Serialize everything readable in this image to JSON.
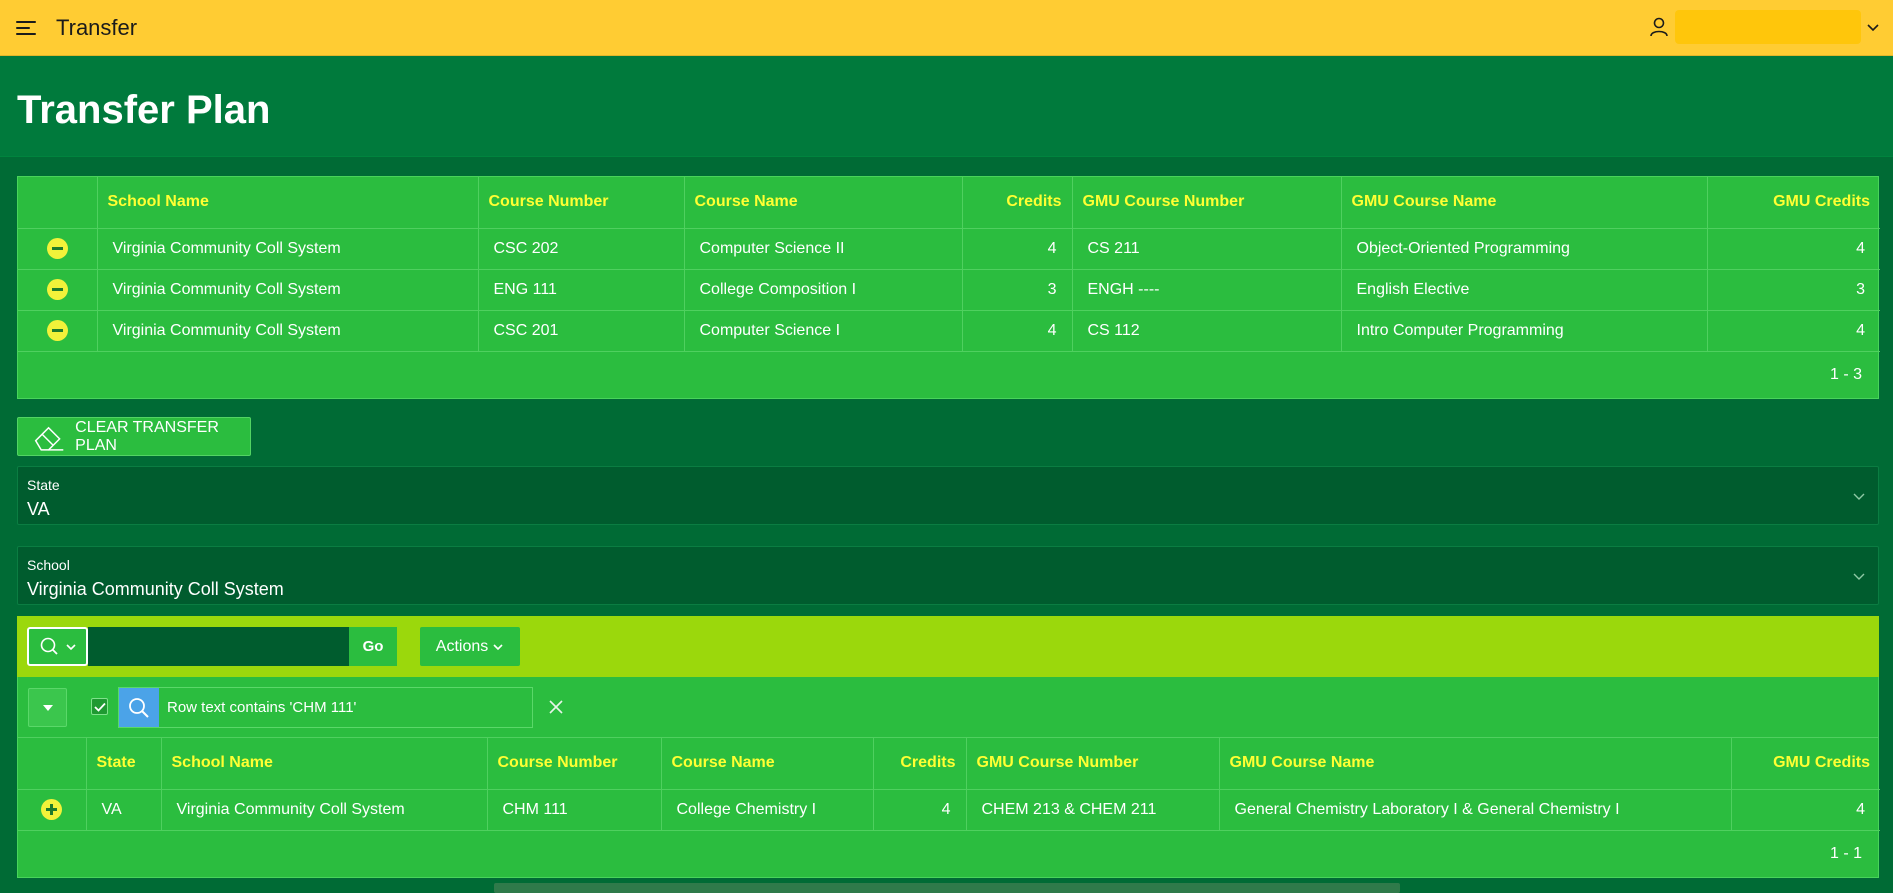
{
  "header": {
    "app_title": "Transfer"
  },
  "page": {
    "title": "Transfer Plan"
  },
  "plan_table": {
    "columns": [
      "",
      "School Name",
      "Course Number",
      "Course Name",
      "Credits",
      "GMU Course Number",
      "GMU Course Name",
      "GMU Credits"
    ],
    "rows": [
      [
        "Virginia Community Coll System",
        "CSC 202",
        "Computer Science II",
        "4",
        "CS 211",
        "Object-Oriented Programming",
        "4"
      ],
      [
        "Virginia Community Coll System",
        "ENG 111",
        "College Composition I",
        "3",
        "ENGH ----",
        "English Elective",
        "3"
      ],
      [
        "Virginia Community Coll System",
        "CSC 201",
        "Computer Science I",
        "4",
        "CS 112",
        "Intro Computer Programming",
        "4"
      ]
    ],
    "pagination": "1 - 3"
  },
  "clear_button": {
    "label": "CLEAR TRANSFER PLAN"
  },
  "state_field": {
    "label": "State",
    "value": "VA"
  },
  "school_field": {
    "label": "School",
    "value": "Virginia Community Coll System"
  },
  "toolbar": {
    "search_value": "",
    "go_label": "Go",
    "actions_label": "Actions"
  },
  "filter": {
    "text": "Row text contains 'CHM 111'"
  },
  "results_table": {
    "columns": [
      "",
      "State",
      "School Name",
      "Course Number",
      "Course Name",
      "Credits",
      "GMU Course Number",
      "GMU Course Name",
      "GMU Credits"
    ],
    "rows": [
      [
        "VA",
        "Virginia Community Coll System",
        "CHM 111",
        "College Chemistry I",
        "4",
        "CHEM 213 & CHEM 211",
        "General Chemistry Laboratory I & General Chemistry I",
        "4"
      ]
    ],
    "pagination": "1 - 1"
  },
  "colors": {
    "header_bg": "#ffcc33",
    "page_bg": "#006b35",
    "region_bg": "#2bbd3f",
    "toolbar_bg": "#9bd80c",
    "column_header_text": "#ffff33",
    "row_button": "#f2f23a"
  },
  "icons": {
    "menu": "hamburger-icon",
    "user": "user-icon",
    "chevron": "chevron-down-icon",
    "eraser": "eraser-icon",
    "search": "search-icon",
    "remove_row": "minus-circle-icon",
    "add_row": "plus-circle-icon",
    "close": "close-icon",
    "check": "check-icon",
    "caret": "caret-down-icon"
  }
}
